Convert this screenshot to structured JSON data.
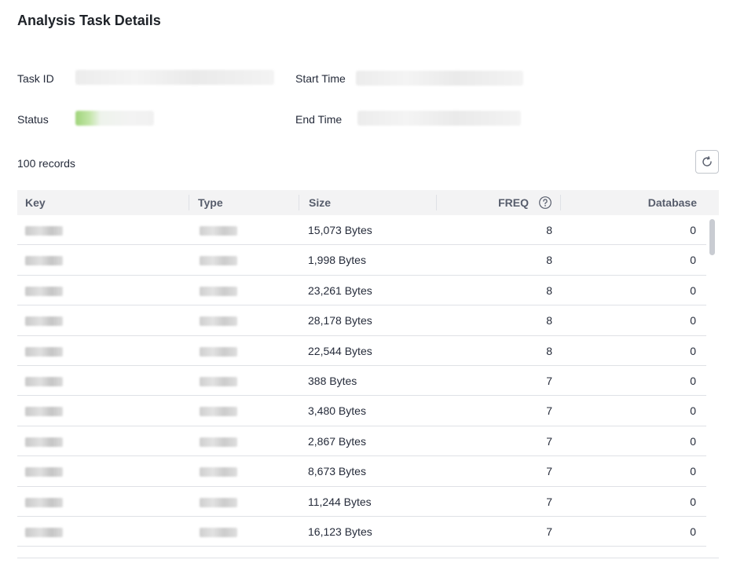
{
  "page": {
    "title": "Analysis Task Details"
  },
  "info": {
    "task_id_label": "Task ID",
    "start_time_label": "Start Time",
    "status_label": "Status",
    "end_time_label": "End Time"
  },
  "records_text": "100 records",
  "icons": {
    "refresh": "refresh-icon",
    "help": "help-circle-icon"
  },
  "table": {
    "columns": [
      "Key",
      "Type",
      "Size",
      "FREQ",
      "Database"
    ],
    "rows": [
      {
        "size": "15,073 Bytes",
        "freq": "8",
        "database": "0"
      },
      {
        "size": "1,998 Bytes",
        "freq": "8",
        "database": "0"
      },
      {
        "size": "23,261 Bytes",
        "freq": "8",
        "database": "0"
      },
      {
        "size": "28,178 Bytes",
        "freq": "8",
        "database": "0"
      },
      {
        "size": "22,544 Bytes",
        "freq": "8",
        "database": "0"
      },
      {
        "size": "388 Bytes",
        "freq": "7",
        "database": "0"
      },
      {
        "size": "3,480 Bytes",
        "freq": "7",
        "database": "0"
      },
      {
        "size": "2,867 Bytes",
        "freq": "7",
        "database": "0"
      },
      {
        "size": "8,673 Bytes",
        "freq": "7",
        "database": "0"
      },
      {
        "size": "11,244 Bytes",
        "freq": "7",
        "database": "0"
      },
      {
        "size": "16,123 Bytes",
        "freq": "7",
        "database": "0"
      }
    ]
  },
  "colors": {
    "status_running": "#9fd47a",
    "header_bg": "#f3f3f4",
    "border": "#dfe1e6"
  }
}
